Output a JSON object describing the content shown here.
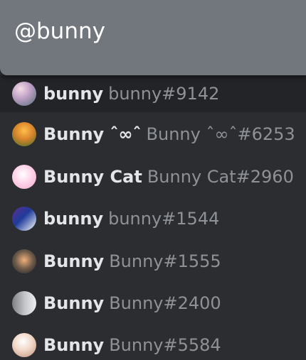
{
  "search": {
    "query": "@bunny"
  },
  "results": [
    {
      "name": "bunny",
      "tag": "bunny#9142",
      "avatar_icon": "anime-girl-avatar-icon"
    },
    {
      "name": "Bunny ˆ∞ˆ",
      "tag": "Bunny ˆ∞ˆ#6253",
      "avatar_icon": "pokemon-avatar-icon"
    },
    {
      "name": "Bunny Cat",
      "tag": "Bunny Cat#2960",
      "avatar_icon": "pink-bunny-avatar-icon"
    },
    {
      "name": "bunny",
      "tag": "bunny#1544",
      "avatar_icon": "purple-avatar-icon"
    },
    {
      "name": "Bunny",
      "tag": "Bunny#1555",
      "avatar_icon": "person-avatar-icon"
    },
    {
      "name": "Bunny",
      "tag": "Bunny#2400",
      "avatar_icon": "gray-avatar-icon"
    },
    {
      "name": "Bunny",
      "tag": "Bunny#5584",
      "avatar_icon": "anime-avatar-icon"
    }
  ],
  "colors": {
    "search_background": "#72767d",
    "panel_background": "#2b2d31",
    "selected_row": "#232428",
    "name_text": "#e3e5e8",
    "tag_text": "#8e9297"
  }
}
